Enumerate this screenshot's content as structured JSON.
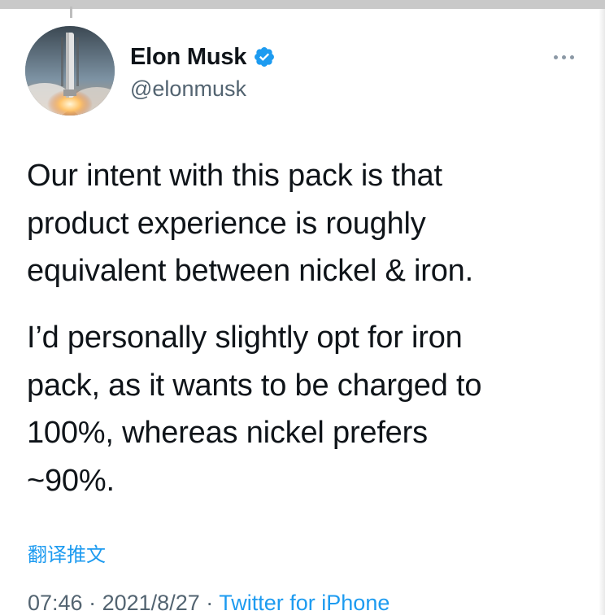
{
  "author": {
    "display_name": "Elon Musk",
    "handle": "@elonmusk",
    "verified": true,
    "verified_icon": "verified-badge-icon",
    "avatar_icon": "rocket-launch-avatar"
  },
  "more_icon": "more-dots-icon",
  "tweet": {
    "paragraphs": [
      "Our intent with this pack is that\nproduct experience is roughly\nequivalent between nickel & iron.",
      "I’d personally slightly opt for iron\npack, as it wants to be charged to\n100%, whereas nickel prefers\n~90%."
    ],
    "translate_label": "翻译推文",
    "time": "07:46",
    "date": "2021/8/27",
    "separator": "·",
    "source": "Twitter for iPhone"
  },
  "colors": {
    "text": "#0f1419",
    "secondary": "#536471",
    "accent": "#1d9bf0"
  }
}
